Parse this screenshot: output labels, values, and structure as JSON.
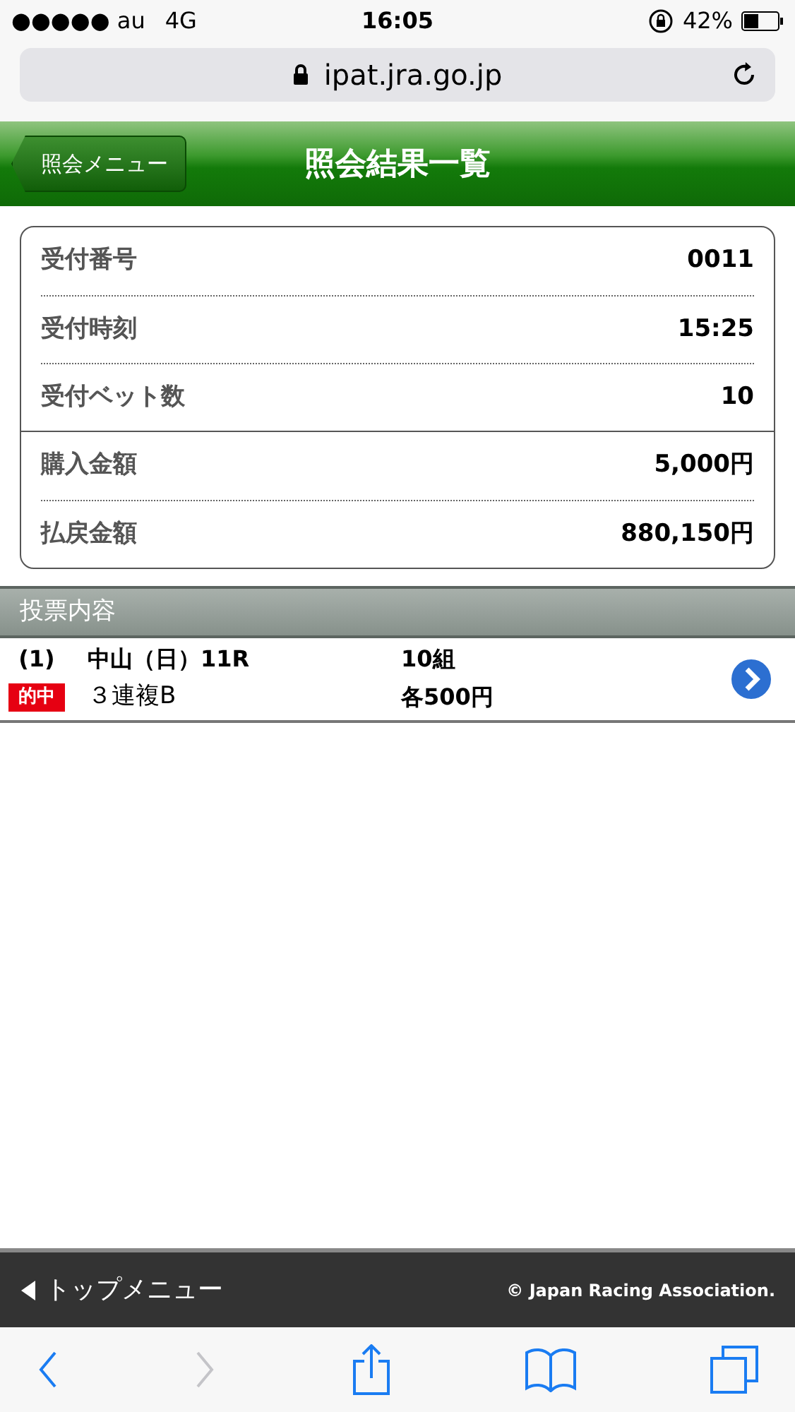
{
  "status_bar": {
    "carrier": "●●●●● au",
    "network": "4G",
    "time": "16:05",
    "battery": "42%"
  },
  "address_bar": {
    "url": "ipat.jra.go.jp"
  },
  "header": {
    "back_button": "照会メニュー",
    "title": "照会結果一覧"
  },
  "summary": {
    "groups": [
      [
        {
          "label": "受付番号",
          "value": "0011"
        },
        {
          "label": "受付時刻",
          "value": "15:25"
        },
        {
          "label": "受付ベット数",
          "value": "10"
        }
      ],
      [
        {
          "label": "購入金額",
          "value": "5,000円"
        },
        {
          "label": "払戻金額",
          "value": "880,150円"
        }
      ]
    ]
  },
  "section": {
    "title": "投票内容"
  },
  "bets": [
    {
      "number": "(1)",
      "race": "中山（日）11R",
      "combinations": "10組",
      "badge": {
        "text": "的中",
        "color": "#e60012"
      },
      "bet_type": "３連複B",
      "amount": "各500円"
    }
  ],
  "footer": {
    "top_menu": "トップメニュー",
    "copyright": "© Japan Racing Association."
  },
  "toolbar": [
    {
      "kind": "back",
      "disabled": false
    },
    {
      "kind": "forward",
      "disabled": true
    },
    {
      "kind": "share",
      "disabled": false
    },
    {
      "kind": "bookmarks",
      "disabled": false
    },
    {
      "kind": "tabs",
      "disabled": false
    }
  ]
}
